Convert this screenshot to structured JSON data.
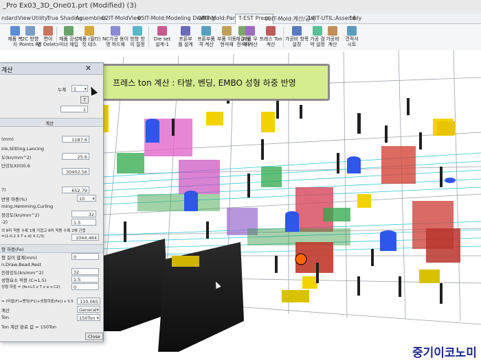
{
  "window": {
    "title": "_Pro Ex03_3D_One01.prt (Modified)  (3)"
  },
  "menu_tabs": [
    "ndard",
    "View",
    "Utility",
    "True Shading",
    "Assemblies",
    "02IT-MoldView",
    "05IT-Mold:Modeling Drafting",
    "08IT-Mold:Parting",
    "T-EST Press",
    "09IT-Mold:계산/공식",
    "14IT-UTIL:Assembly",
    "16"
  ],
  "ribbon": [
    {
      "label": "제품 복\n지",
      "icon": "copy-icon",
      "color": "#5b8dd6"
    },
    {
      "label": "2C 방향\nPoints Ro",
      "icon": "points-icon",
      "color": "#7a9cc8"
    },
    {
      "label": "면아\n면 Delete",
      "icon": "delete-face-icon",
      "color": "#c8745b"
    },
    {
      "label": "제품 강성\n미너 재입",
      "icon": "rib-icon",
      "color": "#6aa36a"
    },
    {
      "label": "제품 (필터)\n컷 테스",
      "icon": "filter-icon",
      "color": "#d6a640"
    },
    {
      "label": "NC가공 용이\n명 하드웨",
      "icon": "nc-icon",
      "color": "#8a8ad6"
    },
    {
      "label": "방향 방\n이 질정",
      "icon": "direction-icon",
      "color": "#5bb6c8"
    },
    {
      "label": "Die set\n설계-1",
      "icon": "die-set-icon",
      "color": "#c85b8d"
    },
    {
      "label": "프론부\n플 설계",
      "icon": "front-icon",
      "color": "#6b6bbb"
    },
    {
      "label": "프론부품\n격 계산",
      "icon": "front-calc-icon",
      "color": "#55a0c0"
    },
    {
      "label": "부품 이동\n현석재",
      "icon": "move-part-icon",
      "color": "#c0a055"
    },
    {
      "label": "체결 및\n전석재",
      "icon": "fasten-icon",
      "color": "#7aa86a"
    },
    {
      "label": "제품 우\n게 계산",
      "icon": "weight-icon",
      "color": "#a06ac0"
    },
    {
      "label": "프레스 Ton\n계산",
      "icon": "press-ton-icon",
      "color": "#c05a5a"
    },
    {
      "label": "가공비 항목\n설정",
      "icon": "cost-icon",
      "color": "#5a7ac0"
    },
    {
      "label": "가공 검\n약 설정",
      "icon": "check-icon",
      "color": "#5ac09a"
    },
    {
      "label": "가공비\n계산",
      "icon": "cost-calc-icon",
      "color": "#c0905a"
    },
    {
      "label": "견적서\n시트",
      "icon": "sheet-icon",
      "color": "#5a9ac0"
    }
  ],
  "callout": {
    "text": "프레스 ton 계산 : 타발, 벤딩, EMBO 성형 하중 반영"
  },
  "dialog": {
    "title": "계산",
    "close": "✕",
    "row_count_label": "누계",
    "row_count_value": "1",
    "t_button": "T",
    "t_value": "1",
    "section_calc": "계산",
    "f_length_label": "(mm)",
    "f_length_value": "1187.6",
    "f_cut_label": "ink,Slitting,Lancing",
    "f_strength_label": "도(kn/mm^2)",
    "f_strength_value": "25.6",
    "f_formula_label": "단강도X(0)0.6",
    "f_result_value": "30402.56",
    "bend_label": "7)",
    "bend_value": "652.79",
    "bend_dir_label": "반영 하중(%)",
    "bend_dir_value": "10",
    "bend_type_label": "ming,Hemming,Curling",
    "bend_strength_label": "장강도(kn/mm^2)",
    "bend_strength_value": "32",
    "bend_coef_label": "-2)",
    "bend_coef_value": "1.5",
    "bend_note": "의 8미 적용 수록 1에 가깝고 8미 적용 수록 2에 근접",
    "bend_formula_label": "=(1-0.2 X T x d) X C/3)",
    "bend_result_value": "1044.464",
    "section_embo": "형 하중(Fe)",
    "embo_len_label": "형 길이 합계(mm)",
    "embo_len_value": "0",
    "embo_type_label": "n,Draw,Bead,Rest",
    "embo_strength_label": "인장강도(kn/mm^2)",
    "embo_strength_value": "32",
    "embo_coef_label": "성형요소 적용 (C=1.5)",
    "embo_coef_value": "1.5",
    "embo_formula_label": "성형 하중 = (fe+L3 x T x α x C2)",
    "embo_result_value": "0",
    "total_label": "= (타발(F)+벤딩(F1)+성형하중(Fe)) x 3.5",
    "total_value": "110.065",
    "machine_label": "계산",
    "machine_value": "General",
    "press_label": "Ton",
    "press_value": "150Ton",
    "result_text": "Ton 계산 완료 값 = 150Ton",
    "close_button": "Close"
  },
  "watermark": {
    "text": "중기이코노미"
  }
}
